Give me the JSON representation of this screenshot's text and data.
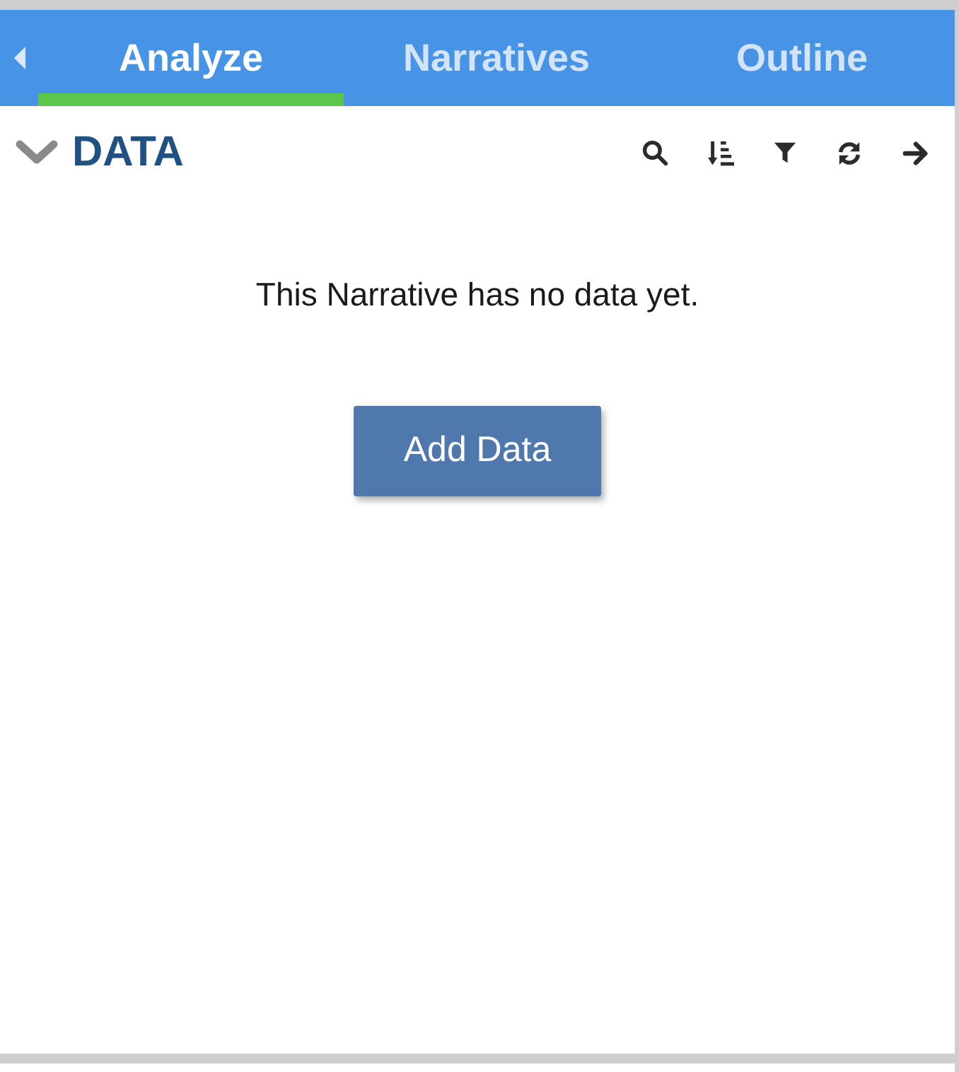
{
  "tabs": [
    {
      "label": "Analyze",
      "selected": true
    },
    {
      "label": "Narratives",
      "selected": false
    },
    {
      "label": "Outline",
      "selected": false
    }
  ],
  "data_panel": {
    "title": "DATA",
    "expanded": true,
    "empty_message": "This Narrative has no data yet.",
    "add_button": "Add Data"
  }
}
